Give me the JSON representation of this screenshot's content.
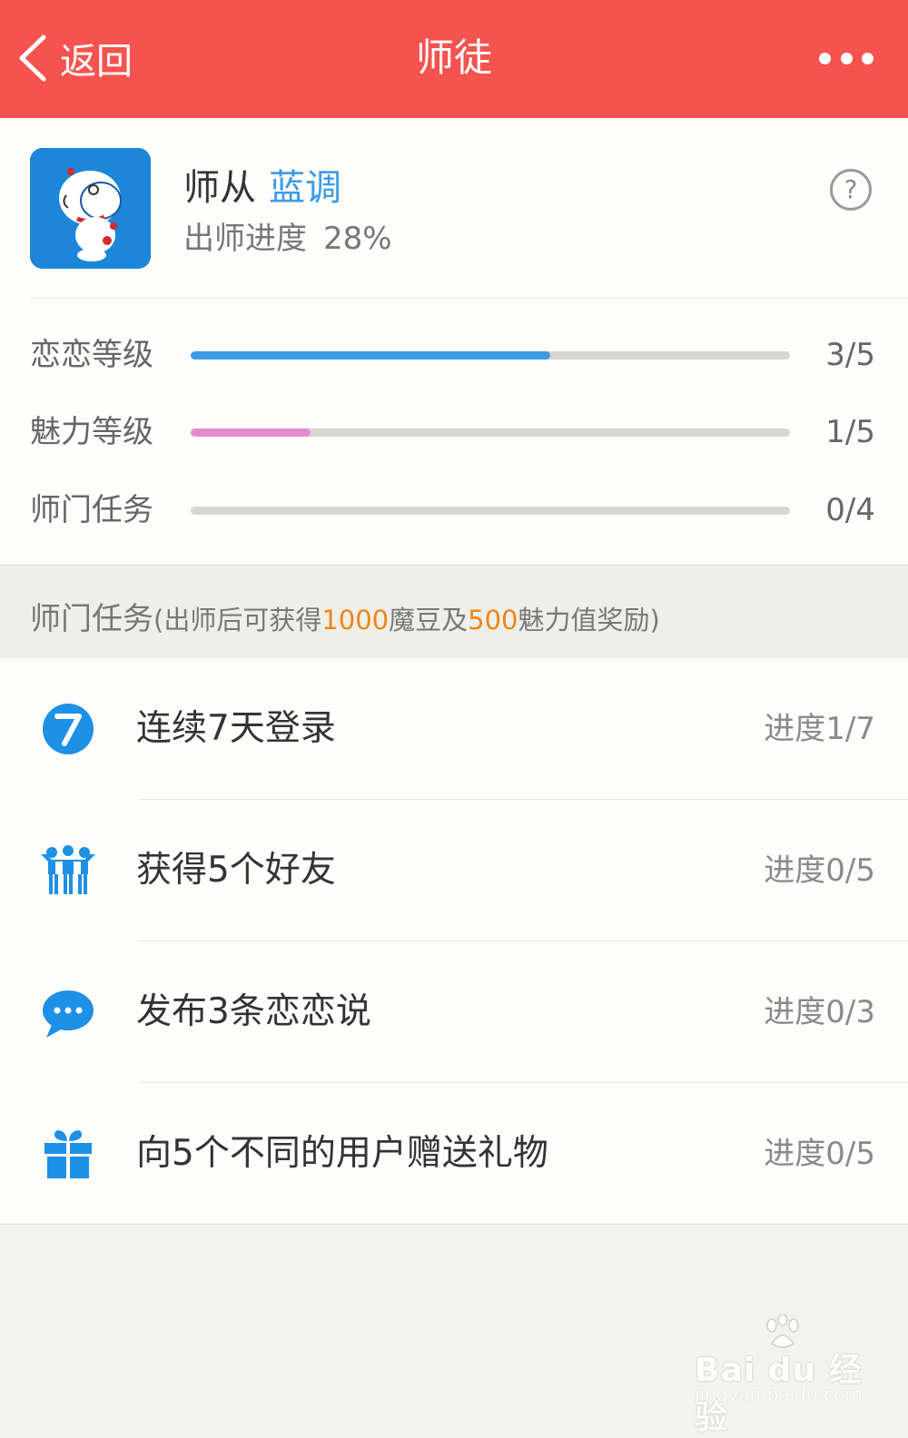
{
  "nav": {
    "back_label": "返回",
    "title": "师徒"
  },
  "profile": {
    "role": "师从",
    "name": "蓝调",
    "progress_label": "出师进度",
    "progress_value": "28%",
    "help_symbol": "?"
  },
  "levels": [
    {
      "label": "恋恋等级",
      "value": "3/5",
      "fraction": 0.6,
      "color": "#3d9be6"
    },
    {
      "label": "魅力等级",
      "value": "1/5",
      "fraction": 0.2,
      "color": "#e68bd0"
    },
    {
      "label": "师门任务",
      "value": "0/4",
      "fraction": 0.0,
      "color": "#3d9be6"
    }
  ],
  "tasks_header": {
    "title": "师门任务",
    "p1": "(出师后可获得",
    "n1": "1000",
    "p2": "魔豆及",
    "n2": "500",
    "p3": "魅力值奖励)"
  },
  "tasks": [
    {
      "icon": "seven-days-icon",
      "name": "连续7天登录",
      "progress": "进度1/7"
    },
    {
      "icon": "friends-icon",
      "name": "获得5个好友",
      "progress": "进度0/5"
    },
    {
      "icon": "chat-bubble-icon",
      "name": "发布3条恋恋说",
      "progress": "进度0/3"
    },
    {
      "icon": "gift-icon",
      "name": "向5个不同的用户赠送礼物",
      "progress": "进度0/5"
    }
  ],
  "watermark": {
    "brand": "Bai du 经验",
    "url": "jingyan.baidu.com"
  },
  "colors": {
    "nav": "#f5534f",
    "accent_blue": "#3d9be6",
    "orange": "#f0841a",
    "pink": "#e68bd0"
  }
}
